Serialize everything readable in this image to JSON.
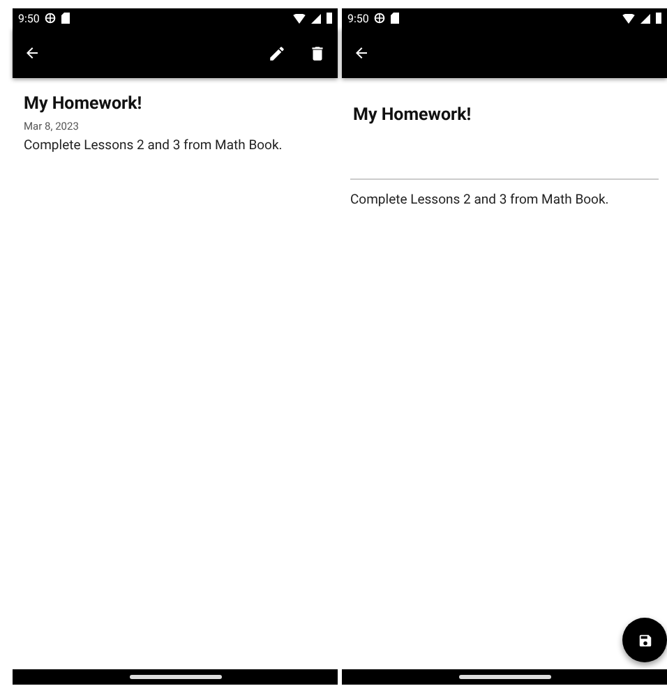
{
  "screens": [
    {
      "kind": "view",
      "status_bar": {
        "time": "9:50"
      },
      "toolbar": {
        "edit_button": true,
        "delete_button": true
      },
      "note": {
        "title": "My Homework!",
        "date": "Mar 8, 2023",
        "body": "Complete Lessons 2 and 3 from Math Book."
      }
    },
    {
      "kind": "edit",
      "status_bar": {
        "time": "9:50"
      },
      "note": {
        "title": "My Homework!",
        "body": "Complete Lessons 2 and 3 from Math Book."
      },
      "save_fab": true
    }
  ]
}
